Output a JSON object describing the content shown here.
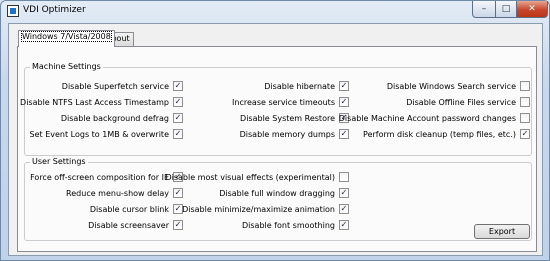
{
  "window": {
    "title": "VDI Optimizer",
    "minimize_symbol": "–",
    "maximize_symbol": "□",
    "close_symbol": "✕"
  },
  "tabs": [
    {
      "label": "Windows 7/Vista/2008",
      "selected": true
    },
    {
      "label": "About",
      "selected": false
    }
  ],
  "machine_settings": {
    "title": "Machine Settings",
    "items": [
      {
        "label": "Disable Superfetch service",
        "checked": true
      },
      {
        "label": "Disable NTFS Last Access Timestamp",
        "checked": true
      },
      {
        "label": "Disable background defrag",
        "checked": true
      },
      {
        "label": "Set Event Logs to 1MB & overwrite",
        "checked": true
      },
      {
        "label": "Disable hibernate",
        "checked": true
      },
      {
        "label": "Increase service timeouts",
        "checked": true
      },
      {
        "label": "Disable System Restore",
        "checked": true
      },
      {
        "label": "Disable memory dumps",
        "checked": true
      },
      {
        "label": "Disable Windows Search service",
        "checked": false
      },
      {
        "label": "Disable Offline Files service",
        "checked": false
      },
      {
        "label": "Disable Machine Account password changes",
        "checked": false
      },
      {
        "label": "Perform disk cleanup (temp files, etc.)",
        "checked": true
      }
    ]
  },
  "user_settings": {
    "title": "User Settings",
    "items": [
      {
        "label": "Force off-screen composition for IE",
        "checked": true
      },
      {
        "label": "Reduce menu-show delay",
        "checked": true
      },
      {
        "label": "Disable cursor blink",
        "checked": true
      },
      {
        "label": "Disable screensaver",
        "checked": true
      },
      {
        "label": "Disable most visual effects (experimental)",
        "checked": false
      },
      {
        "label": "Disable full window dragging",
        "checked": true
      },
      {
        "label": "Disable minimize/maximize animation",
        "checked": true
      },
      {
        "label": "Disable font smoothing",
        "checked": true
      }
    ]
  },
  "export_button": {
    "label": "Export"
  },
  "check_glyph": "✓"
}
